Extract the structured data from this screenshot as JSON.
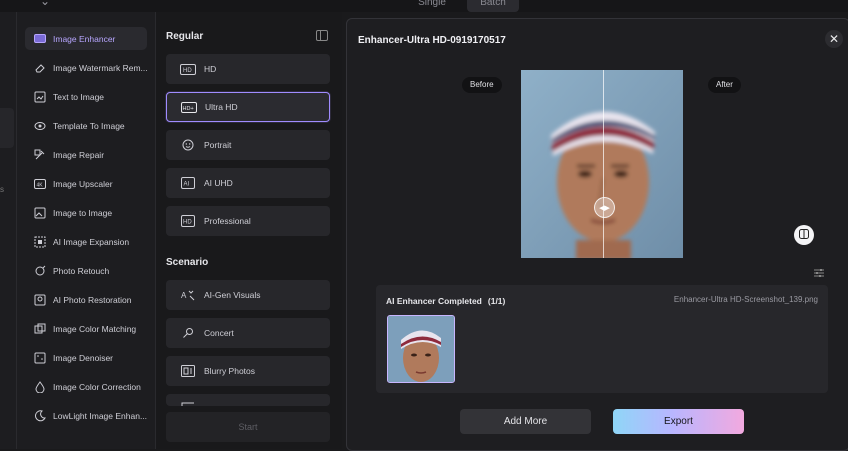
{
  "topbar": {
    "seg_a": "Single",
    "seg_b": "Batch"
  },
  "rail": {
    "labels": [
      "s"
    ]
  },
  "sidebar": {
    "items": [
      {
        "label": "Image Enhancer",
        "icon": "hd-icon",
        "active": true
      },
      {
        "label": "Image Watermark Rem...",
        "icon": "eraser-icon"
      },
      {
        "label": "Text to Image",
        "icon": "image-text-icon"
      },
      {
        "label": "Template To Image",
        "icon": "template-icon"
      },
      {
        "label": "Image Repair",
        "icon": "repair-icon"
      },
      {
        "label": "Image Upscaler",
        "icon": "upscale-icon"
      },
      {
        "label": "Image to Image",
        "icon": "image-icon"
      },
      {
        "label": "AI Image Expansion",
        "icon": "expand-icon"
      },
      {
        "label": "Photo Retouch",
        "icon": "retouch-icon"
      },
      {
        "label": "AI Photo Restoration",
        "icon": "restore-icon"
      },
      {
        "label": "Image Color Matching",
        "icon": "color-match-icon"
      },
      {
        "label": "Image Denoiser",
        "icon": "denoise-icon"
      },
      {
        "label": "Image Color Correction",
        "icon": "color-correct-icon"
      },
      {
        "label": "LowLight Image Enhan...",
        "icon": "lowlight-icon"
      }
    ]
  },
  "modes": {
    "regular_title": "Regular",
    "regular": [
      {
        "label": "HD",
        "badge": "HD"
      },
      {
        "label": "Ultra HD",
        "badge": "HD+",
        "selected": true
      },
      {
        "label": "Portrait",
        "badge": "face"
      },
      {
        "label": "AI UHD",
        "badge": "AI"
      },
      {
        "label": "Professional",
        "badge": "HD"
      }
    ],
    "scenario_title": "Scenario",
    "scenario": [
      {
        "label": "AI-Gen Visuals"
      },
      {
        "label": "Concert"
      },
      {
        "label": "Blurry Photos"
      }
    ],
    "start_label": "Start"
  },
  "main": {
    "title": "Enhancer-Ultra HD-0919170517",
    "before_label": "Before",
    "after_label": "After",
    "results_title": "AI Enhancer Completed",
    "results_count": "(1/1)",
    "results_file": "Enhancer-Ultra HD-Screenshot_139.png",
    "add_more_label": "Add More",
    "export_label": "Export"
  },
  "colors": {
    "accent": "#a08cff",
    "export_start": "#8fd6f7",
    "export_end": "#f2a9df"
  }
}
